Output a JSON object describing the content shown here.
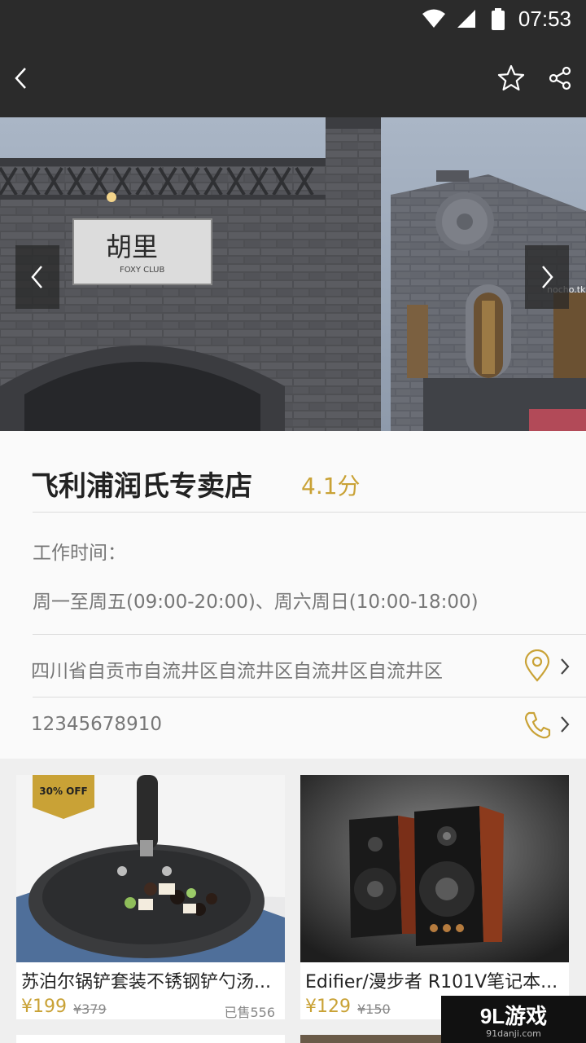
{
  "status": {
    "time": "07:53"
  },
  "nav": {
    "back_icon": "back-icon",
    "favorite_icon": "star-icon",
    "share_icon": "share-icon"
  },
  "banner": {
    "sign_name": "胡里",
    "sign_sub": "FOXY CLUB",
    "watermark": "nocho.tk"
  },
  "shop": {
    "name": "飞利浦润氏专卖店",
    "rating": "4.1分",
    "hours_label": "工作时间：",
    "hours": "周一至周五(09:00-20:00)、周六周日(10:00-18:00)",
    "address": "四川省自贡市自流井区自流井区自流井区自流井区",
    "phone": "12345678910"
  },
  "products": [
    {
      "title": "苏泊尔锅铲套装不锈钢铲勺汤...",
      "price": "¥199",
      "old_price": "¥379",
      "sold": "已售556",
      "badge": "30% OFF"
    },
    {
      "title": "Edifier/漫步者 R101V笔记本...",
      "price": "¥129",
      "old_price": "¥150",
      "sold": ""
    }
  ],
  "watermark": {
    "main": "9L游戏",
    "sub": "91danji.com"
  },
  "colors": {
    "accent": "#c9a236",
    "bar": "#2b2b2b"
  }
}
